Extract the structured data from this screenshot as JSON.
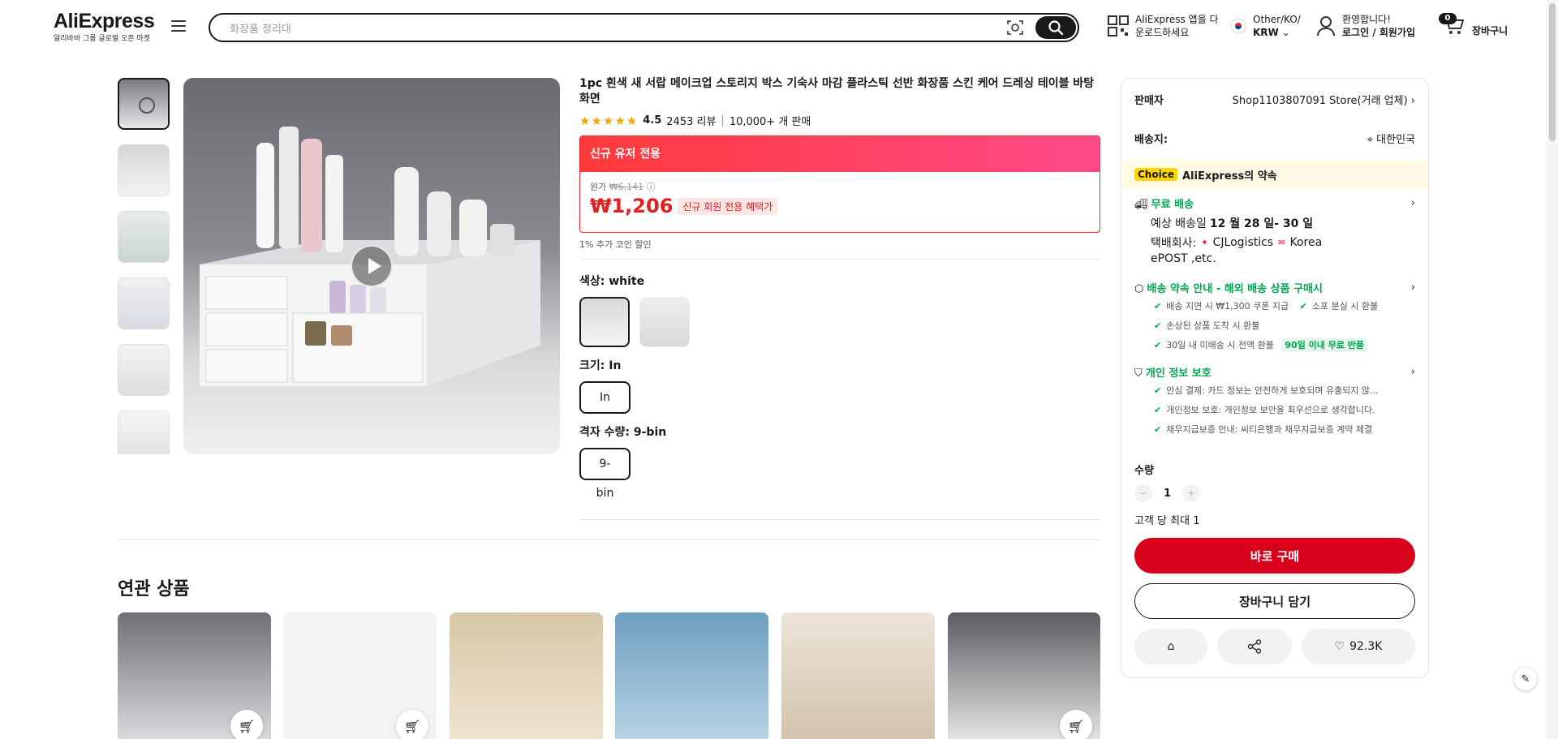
{
  "header": {
    "logo": "AliExpress",
    "logo_sub": "알리바바 그룹 글로벌 오픈 마켓",
    "search_placeholder": "화장품 정리대",
    "app_line1": "AliExpress 앱을 다",
    "app_line2": "운로드하세요",
    "region_line1": "Other/KO/",
    "region_line2": "KRW",
    "account_line1": "환영합니다!",
    "account_line2": "로그인 / 회원가입",
    "cart_count": "0",
    "cart_label": "장바구니"
  },
  "product": {
    "title": "1pc 흰색 새 서랍 메이크업 스토리지 박스 기숙사 마감 플라스틱 선반 화장품 스킨 케어 드레싱 테이블 바탕 화면",
    "rating": "4.5",
    "reviews": "2453 리뷰",
    "sold": "10,000+ 개 판매",
    "promo_title": "신규 유저 전용",
    "orig_label": "원가",
    "orig_price": "₩6,141",
    "price": "₩1,206",
    "price_tag": "신규 회원 전용 혜택가",
    "coin": "1% 추가 코인 할인",
    "color_label": "색상:",
    "color_value": "white",
    "size_label": "크기:",
    "size_value": "In",
    "size_option": "In",
    "grid_label": "격자 수량:",
    "grid_value": "9-bin",
    "grid_option": "9-bin"
  },
  "panel": {
    "seller_label": "판매자",
    "seller_value": "Shop1103807091 Store(거래 업체)",
    "ship_to_label": "배송지:",
    "ship_to_value": "대한민국",
    "choice_badge": "Choice",
    "choice_text": "AliExpress의 약속",
    "free_ship": "무료 배송",
    "eta_prefix": "예상 배송일",
    "eta_value": "12 월 28 일- 30 일",
    "courier_label": "택배회사:",
    "courier1": "CJLogistics",
    "courier2": "Korea",
    "courier3": "ePOST ,etc.",
    "promise_title": "배송 약속 안내 - 해외 배송 상품 구매시",
    "promise1": "배송 지연 시 ₩1,300 쿠폰 지급",
    "promise2": "소포 분실 시 환불",
    "promise3": "손상된 상품 도착 시 환불",
    "promise4": "30일 내 미배송 시 전액 환불",
    "promise4_tag": "90일 이내 무료 반품",
    "privacy_title": "개인 정보 보호",
    "privacy1": "안심 결제: 카드 정보는 안전하게 보호되며 유출되지 않...",
    "privacy2": "개인정보 보호: 개인정보 보안을 최우선으로 생각합니다.",
    "privacy3": "채무지급보증 안내: 씨티은행과 채무지급보증 계약 체결",
    "qty_label": "수량",
    "qty_value": "1",
    "qty_limit": "고객 당 최대 1",
    "buy_now": "바로 구매",
    "add_cart": "장바구니 담기",
    "likes": "92.3K"
  },
  "related": {
    "title": "연관 상품"
  }
}
